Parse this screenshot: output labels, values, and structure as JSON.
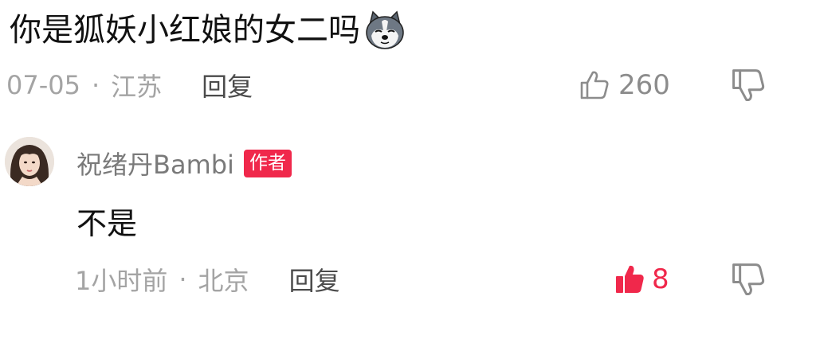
{
  "comment": {
    "text": "你是狐妖小红娘的女二吗",
    "emoji": "husky-dog-emoji",
    "date": "07-05",
    "separator": "·",
    "location": "江苏",
    "reply_label": "回复",
    "like_count": "260",
    "like_icon": "thumbs-up-outline-icon",
    "dislike_icon": "thumbs-down-outline-icon"
  },
  "reply": {
    "author": "祝绪丹Bambi",
    "badge": "作者",
    "text": "不是",
    "time": "1小时前",
    "separator": "·",
    "location": "北京",
    "reply_label": "回复",
    "like_count": "8",
    "liked": true,
    "like_icon": "thumbs-up-filled-icon",
    "dislike_icon": "thumbs-down-outline-icon"
  },
  "colors": {
    "accent": "#f0284b",
    "meta_text": "#a4a4a4",
    "body_text": "#111111"
  }
}
